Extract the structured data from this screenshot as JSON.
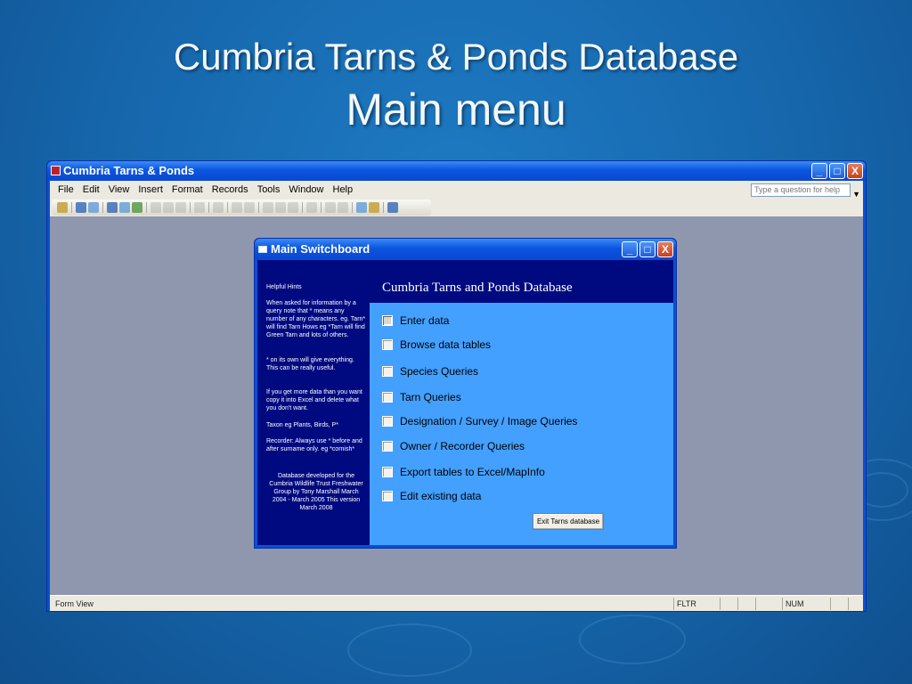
{
  "slide": {
    "title_line1": "Cumbria Tarns & Ponds Database",
    "title_line2": "Main menu"
  },
  "app_window": {
    "title": "Cumbria Tarns & Ponds",
    "controls": {
      "minimize": "_",
      "maximize": "□",
      "close": "X"
    },
    "menu": [
      "File",
      "Edit",
      "View",
      "Insert",
      "Format",
      "Records",
      "Tools",
      "Window",
      "Help"
    ],
    "help_placeholder": "Type a question for help",
    "status": {
      "left": "Form View",
      "cells": [
        "FLTR",
        "",
        "",
        "",
        "NUM",
        "",
        ""
      ]
    }
  },
  "switchboard": {
    "title": "Main Switchboard",
    "heading": "Cumbria Tarns and Ponds Database",
    "hints_title": "Helpful Hints",
    "hints": [
      "When asked for information by a query note that * means any number of any characters. eg. Tarn* will find Tarn Hows eg *Tarn will find Green Tarn and lots of others.",
      "* on its own will give everything. This can be really useful.",
      "If you get more data than you want copy it into Excel and delete what you don't want.",
      "Taxon eg Plants, Birds, P*",
      "Recorder: Always use * before and after surname only. eg *cornish*"
    ],
    "credits": "Database developed for the Cumbria Wildlife Trust Freshwater Group by Tony Marshall March 2004 - March 2005 This version March 2008",
    "options": [
      "Enter data",
      "Browse data tables",
      "Species Queries",
      "Tarn Queries",
      "Designation / Survey / Image Queries",
      "Owner / Recorder Queries",
      "Export tables to Excel/MapInfo",
      "Edit existing data"
    ],
    "exit_label": "Exit Tarns database"
  }
}
